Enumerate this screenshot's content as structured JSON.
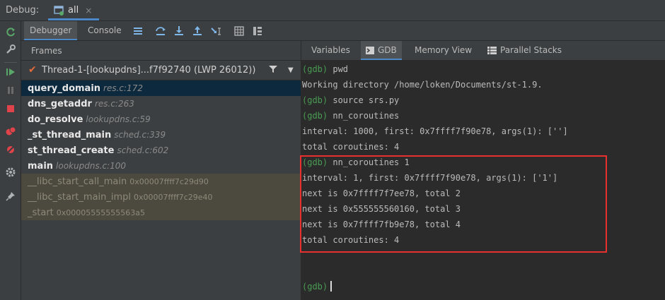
{
  "title": {
    "label": "Debug:",
    "tab": "all"
  },
  "toolbar": {
    "debugger_tab": "Debugger",
    "console_tab": "Console"
  },
  "frames": {
    "header": "Frames",
    "thread": "Thread-1-[lookupdns]...f7f92740 (LWP 26012))",
    "items": [
      {
        "fn": "query_domain",
        "loc": "res.c:172"
      },
      {
        "fn": "dns_getaddr",
        "loc": "res.c:263"
      },
      {
        "fn": "do_resolve",
        "loc": "lookupdns.c:59"
      },
      {
        "fn": "_st_thread_main",
        "loc": "sched.c:339"
      },
      {
        "fn": "st_thread_create",
        "loc": "sched.c:602"
      },
      {
        "fn": "main",
        "loc": "lookupdns.c:100"
      },
      {
        "fn": "__libc_start_call_main",
        "loc": "0x00007ffff7c29d90"
      },
      {
        "fn": "__libc_start_main_impl",
        "loc": "0x00007ffff7c29e40"
      },
      {
        "fn": "_start",
        "loc": "0x00005555555563a5"
      }
    ]
  },
  "right_tabs": {
    "variables": "Variables",
    "gdb": "GDB",
    "memory": "Memory View",
    "parallel": "Parallel Stacks"
  },
  "console": {
    "prompt": "(gdb)",
    "lines": [
      {
        "prompt": "(gdb)",
        "text": " pwd"
      },
      {
        "text": "Working directory /home/loken/Documents/st-1.9."
      },
      {
        "prompt": "(gdb)",
        "text": " source srs.py"
      },
      {
        "prompt": "(gdb)",
        "text": " nn_coroutines"
      },
      {
        "text": "interval: 1000, first: 0x7ffff7f90e78, args(1): ['']"
      },
      {
        "text": "total coroutines: 4"
      },
      {
        "prompt": "(gdb)",
        "text": " nn_coroutines 1"
      },
      {
        "text": "interval: 1, first: 0x7ffff7f90e78, args(1): ['1']"
      },
      {
        "text": "next is 0x7ffff7f7ee78, total 2"
      },
      {
        "text": "next is 0x555555560160, total 3"
      },
      {
        "text": "next is 0x7ffff7fb9e78, total 4"
      },
      {
        "text": "total coroutines: 4"
      }
    ]
  },
  "colors": {
    "prompt": "#499c54",
    "highlight": "#e8312e",
    "selected": "#0d293e"
  }
}
